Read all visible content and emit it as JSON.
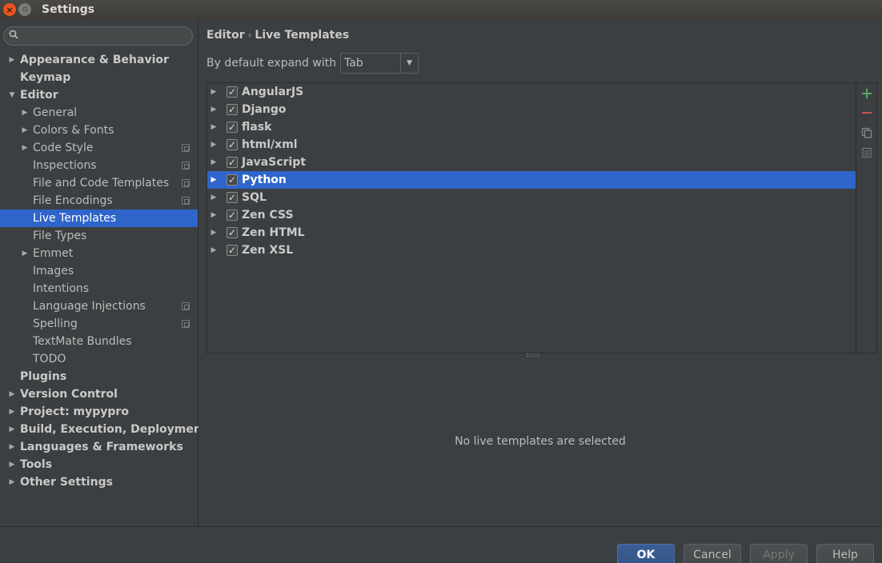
{
  "window": {
    "title": "Settings"
  },
  "search": {
    "placeholder": ""
  },
  "sidebar": {
    "items": [
      {
        "label": "Appearance & Behavior",
        "level": 0,
        "expandable": true,
        "expanded": false,
        "bold": true
      },
      {
        "label": "Keymap",
        "level": 0,
        "expandable": false,
        "bold": true
      },
      {
        "label": "Editor",
        "level": 0,
        "expandable": true,
        "expanded": true,
        "bold": true
      },
      {
        "label": "General",
        "level": 1,
        "expandable": true,
        "expanded": false
      },
      {
        "label": "Colors & Fonts",
        "level": 1,
        "expandable": true,
        "expanded": false
      },
      {
        "label": "Code Style",
        "level": 1,
        "expandable": true,
        "expanded": false,
        "project_icon": true
      },
      {
        "label": "Inspections",
        "level": 1,
        "expandable": false,
        "project_icon": true
      },
      {
        "label": "File and Code Templates",
        "level": 1,
        "expandable": false,
        "project_icon": true
      },
      {
        "label": "File Encodings",
        "level": 1,
        "expandable": false,
        "project_icon": true
      },
      {
        "label": "Live Templates",
        "level": 1,
        "expandable": false,
        "selected": true
      },
      {
        "label": "File Types",
        "level": 1,
        "expandable": false
      },
      {
        "label": "Emmet",
        "level": 1,
        "expandable": true,
        "expanded": false
      },
      {
        "label": "Images",
        "level": 1,
        "expandable": false
      },
      {
        "label": "Intentions",
        "level": 1,
        "expandable": false
      },
      {
        "label": "Language Injections",
        "level": 1,
        "expandable": false,
        "project_icon": true
      },
      {
        "label": "Spelling",
        "level": 1,
        "expandable": false,
        "project_icon": true
      },
      {
        "label": "TextMate Bundles",
        "level": 1,
        "expandable": false
      },
      {
        "label": "TODO",
        "level": 1,
        "expandable": false
      },
      {
        "label": "Plugins",
        "level": 0,
        "expandable": false,
        "bold": true
      },
      {
        "label": "Version Control",
        "level": 0,
        "expandable": true,
        "expanded": false,
        "bold": true
      },
      {
        "label": "Project: mypypro",
        "level": 0,
        "expandable": true,
        "expanded": false,
        "bold": true
      },
      {
        "label": "Build, Execution, Deployment",
        "level": 0,
        "expandable": true,
        "expanded": false,
        "bold": true
      },
      {
        "label": "Languages & Frameworks",
        "level": 0,
        "expandable": true,
        "expanded": false,
        "bold": true
      },
      {
        "label": "Tools",
        "level": 0,
        "expandable": true,
        "expanded": false,
        "bold": true
      },
      {
        "label": "Other Settings",
        "level": 0,
        "expandable": true,
        "expanded": false,
        "bold": true
      }
    ]
  },
  "main": {
    "breadcrumb": {
      "parent": "Editor",
      "separator": "›",
      "current": "Live Templates"
    },
    "expand_with": {
      "label": "By default expand with",
      "value": "Tab"
    },
    "template_groups": [
      {
        "name": "AngularJS",
        "checked": true
      },
      {
        "name": "Django",
        "checked": true
      },
      {
        "name": "flask",
        "checked": true
      },
      {
        "name": "html/xml",
        "checked": true
      },
      {
        "name": "JavaScript",
        "checked": true
      },
      {
        "name": "Python",
        "checked": true,
        "selected": true
      },
      {
        "name": "SQL",
        "checked": true
      },
      {
        "name": "Zen CSS",
        "checked": true
      },
      {
        "name": "Zen HTML",
        "checked": true
      },
      {
        "name": "Zen XSL",
        "checked": true
      }
    ],
    "tools": {
      "add_icon": "plus-icon",
      "remove_icon": "minus-icon",
      "copy_icon": "copy-icon",
      "edit_icon": "edit-icon"
    },
    "empty_message": "No live templates are selected"
  },
  "footer": {
    "ok": "OK",
    "cancel": "Cancel",
    "apply": "Apply",
    "help": "Help"
  },
  "colors": {
    "accent": "#2f65ca",
    "add": "#59a869",
    "remove": "#c75450"
  }
}
